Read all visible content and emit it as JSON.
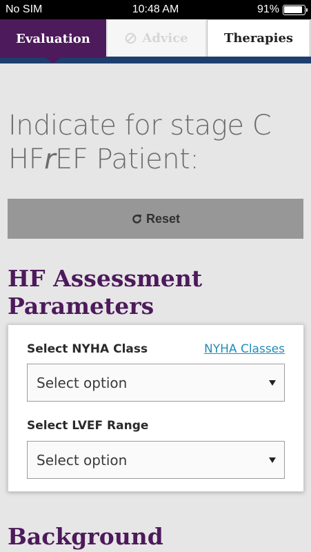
{
  "status_bar": {
    "carrier": "No SIM",
    "time": "10:48 AM",
    "battery": "91%"
  },
  "tabs": [
    {
      "label": "Evaluation",
      "state": "active"
    },
    {
      "label": "Advice",
      "state": "disabled"
    },
    {
      "label": "Therapies",
      "state": "inactive"
    }
  ],
  "heading": {
    "line1": "Indicate for stage C",
    "line2_a": "HF",
    "line2_italic": "r",
    "line2_b": "EF Patient:"
  },
  "reset_label": "Reset",
  "hf_section": {
    "title_line1": "HF Assessment",
    "title_line2": "Parameters",
    "nyha_label": "Select NYHA Class",
    "nyha_link": "NYHA Classes",
    "nyha_select_value": "Select option",
    "lvef_label": "Select LVEF Range",
    "lvef_select_value": "Select option"
  },
  "background_section": {
    "title": "Background"
  },
  "colors": {
    "brand_purple": "#4d1a5b",
    "nav_blue": "#1c3f6e",
    "link_blue": "#1f8db8"
  },
  "icons": [
    "battery-icon",
    "ban-icon",
    "refresh-icon",
    "caret-down-icon"
  ]
}
